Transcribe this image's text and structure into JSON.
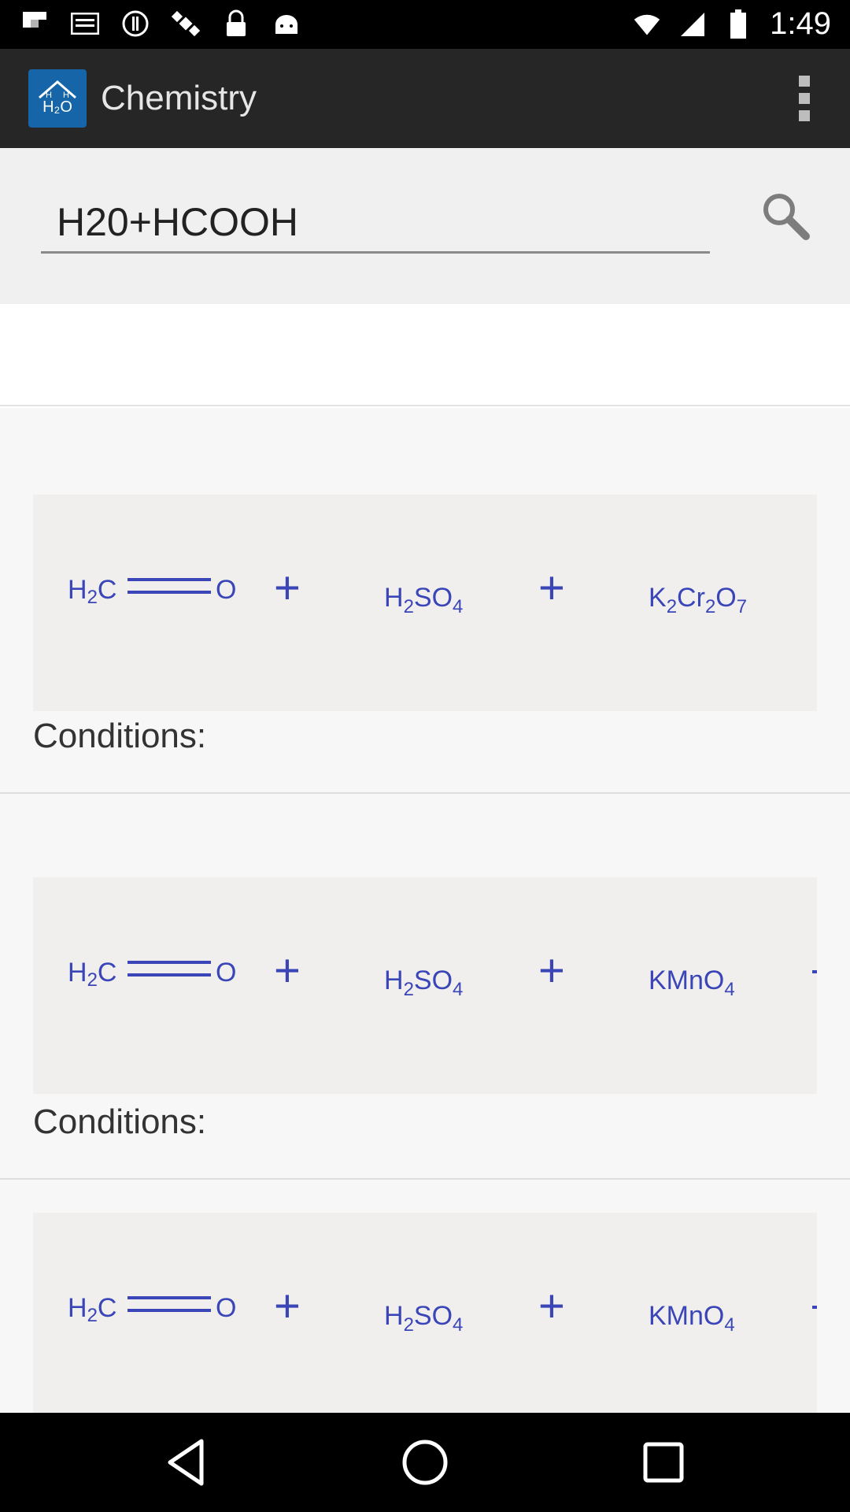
{
  "status_bar": {
    "time": "1:49",
    "notification_icons": [
      "flipboard-icon",
      "mail-icon",
      "alert-icon",
      "satellite-icon",
      "lock-icon",
      "android-icon"
    ],
    "system_icons": [
      "wifi-icon",
      "signal-icon",
      "battery-icon"
    ]
  },
  "app_bar": {
    "title": "Chemistry",
    "logo_text": "H2O",
    "menu_icon": "overflow-menu-icon"
  },
  "search": {
    "value": "H20+HCOOH",
    "icon": "search-icon"
  },
  "results": [
    {
      "reactants": [
        {
          "base": "H",
          "sub": "2",
          "rest": "C═O"
        },
        {
          "plus": "+"
        },
        {
          "formula": "H₂SO₄"
        },
        {
          "plus": "+"
        },
        {
          "formula": "K₂Cr₂O₇"
        }
      ],
      "conditions_label": "Conditions:"
    },
    {
      "reactants": [
        {
          "formula": "H₂C═O"
        },
        {
          "plus": "+"
        },
        {
          "formula": "H₂SO₄"
        },
        {
          "plus": "+"
        },
        {
          "formula": "KMnO₄"
        }
      ],
      "conditions_label": "Conditions:"
    },
    {
      "reactants": [
        {
          "formula": "H₂C═O"
        },
        {
          "plus": "+"
        },
        {
          "formula": "H₂SO₄"
        },
        {
          "plus": "+"
        },
        {
          "formula": "KMnO₄"
        }
      ],
      "conditions_label": ""
    }
  ],
  "nav_bar": {
    "buttons": [
      "back-icon",
      "home-icon",
      "recents-icon"
    ]
  },
  "colors": {
    "formula_blue": "#3a46b8",
    "app_bar": "#262626",
    "logo_bg": "#1565a8"
  }
}
